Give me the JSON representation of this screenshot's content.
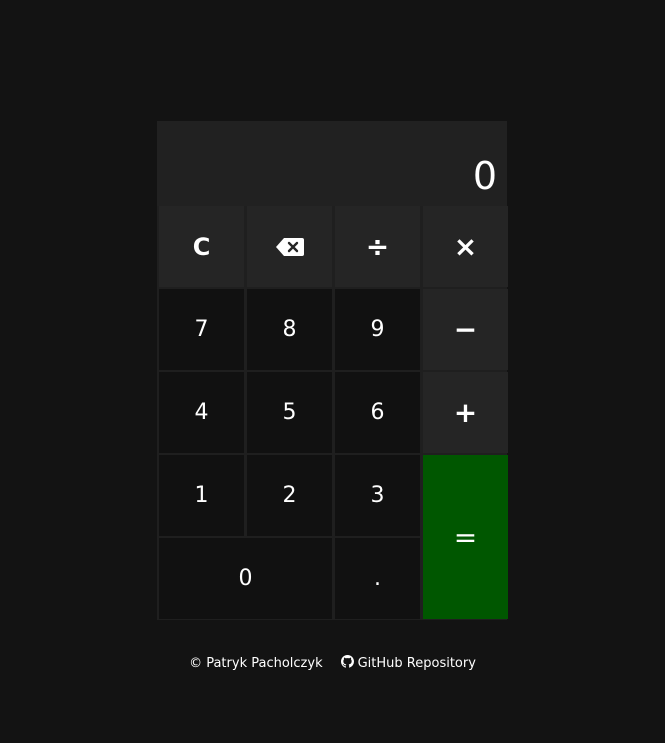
{
  "display": {
    "value": "0"
  },
  "keys": {
    "clear": "C",
    "backspace_icon": "backspace-icon",
    "divide": "÷",
    "multiply": "×",
    "seven": "7",
    "eight": "8",
    "nine": "9",
    "minus": "−",
    "four": "4",
    "five": "5",
    "six": "6",
    "plus": "+",
    "one": "1",
    "two": "2",
    "three": "3",
    "equals": "=",
    "zero": "0",
    "decimal": "."
  },
  "footer": {
    "copyright": "© Patryk Pacholczyk",
    "github_icon": "github-icon",
    "repo_link": "GitHub Repository"
  },
  "colors": {
    "background": "#131313",
    "display_bg": "#212121",
    "function_key_bg": "#252525",
    "digit_key_bg": "#111111",
    "equals_bg": "#005700"
  }
}
